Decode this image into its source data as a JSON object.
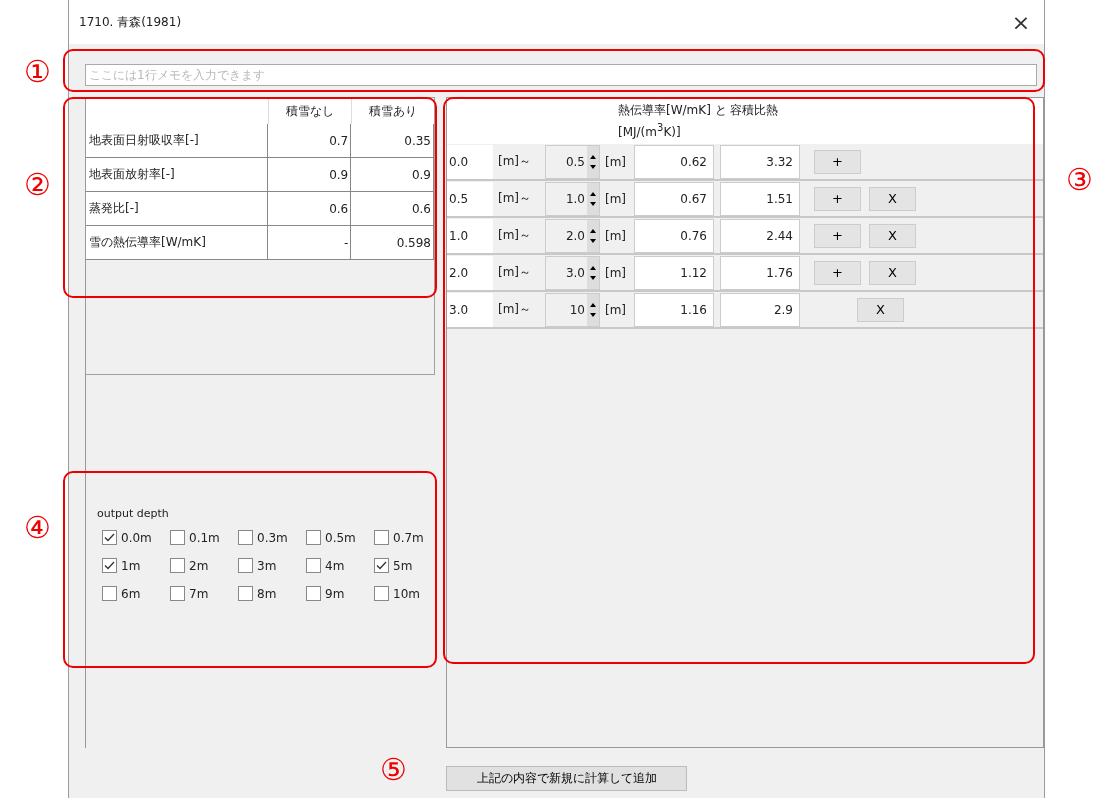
{
  "window": {
    "title": "1710. 青森(1981)",
    "close": "×"
  },
  "memo": {
    "placeholder": "ここには1行メモを入力できます"
  },
  "properties": {
    "columns": [
      "積雪なし",
      "積雪あり"
    ],
    "rows": [
      {
        "label": "地表面日射吸収率[-]",
        "values": [
          "0.7",
          "0.35"
        ]
      },
      {
        "label": "地表面放射率[-]",
        "values": [
          "0.9",
          "0.9"
        ]
      },
      {
        "label": "蒸発比[-]",
        "values": [
          "0.6",
          "0.6"
        ]
      },
      {
        "label": "雪の熱伝導率[W/mK]",
        "values": [
          "-",
          "0.598"
        ]
      }
    ]
  },
  "output_depth": {
    "label": "output depth",
    "options": [
      {
        "label": "0.0m",
        "checked": true
      },
      {
        "label": "0.1m",
        "checked": false
      },
      {
        "label": "0.3m",
        "checked": false
      },
      {
        "label": "0.5m",
        "checked": false
      },
      {
        "label": "0.7m",
        "checked": false
      },
      {
        "label": "1m",
        "checked": true
      },
      {
        "label": "2m",
        "checked": false
      },
      {
        "label": "3m",
        "checked": false
      },
      {
        "label": "4m",
        "checked": false
      },
      {
        "label": "5m",
        "checked": true
      },
      {
        "label": "6m",
        "checked": false
      },
      {
        "label": "7m",
        "checked": false
      },
      {
        "label": "8m",
        "checked": false
      },
      {
        "label": "9m",
        "checked": false
      },
      {
        "label": "10m",
        "checked": false
      }
    ]
  },
  "layers": {
    "header": "熱伝導率[W/mK] と 容積比熱[MJ/(m$^{3}$K)]",
    "rows": [
      {
        "from": "0.0",
        "unit_from": "[m]～",
        "to": "0.5",
        "unit_to": "[m]",
        "conductivity": "0.62",
        "heat_capacity": "3.32",
        "add": "+",
        "remove": null
      },
      {
        "from": "0.5",
        "unit_from": "[m]～",
        "to": "1.0",
        "unit_to": "[m]",
        "conductivity": "0.67",
        "heat_capacity": "1.51",
        "add": "+",
        "remove": "X"
      },
      {
        "from": "1.0",
        "unit_from": "[m]～",
        "to": "2.0",
        "unit_to": "[m]",
        "conductivity": "0.76",
        "heat_capacity": "2.44",
        "add": "+",
        "remove": "X"
      },
      {
        "from": "2.0",
        "unit_from": "[m]～",
        "to": "3.0",
        "unit_to": "[m]",
        "conductivity": "1.12",
        "heat_capacity": "1.76",
        "add": "+",
        "remove": "X"
      },
      {
        "from": "3.0",
        "unit_from": "[m]～",
        "to": "10",
        "unit_to": "[m]",
        "conductivity": "1.16",
        "heat_capacity": "2.9",
        "add": null,
        "remove": "X"
      }
    ]
  },
  "footer": {
    "button": "上記の内容で新規に計算して追加"
  },
  "annotations": [
    {
      "label": "①",
      "kind": "box"
    },
    {
      "label": "②",
      "kind": "box"
    },
    {
      "label": "③",
      "kind": "box"
    },
    {
      "label": "④",
      "kind": "box"
    },
    {
      "label": "⑤",
      "kind": "plain"
    }
  ]
}
